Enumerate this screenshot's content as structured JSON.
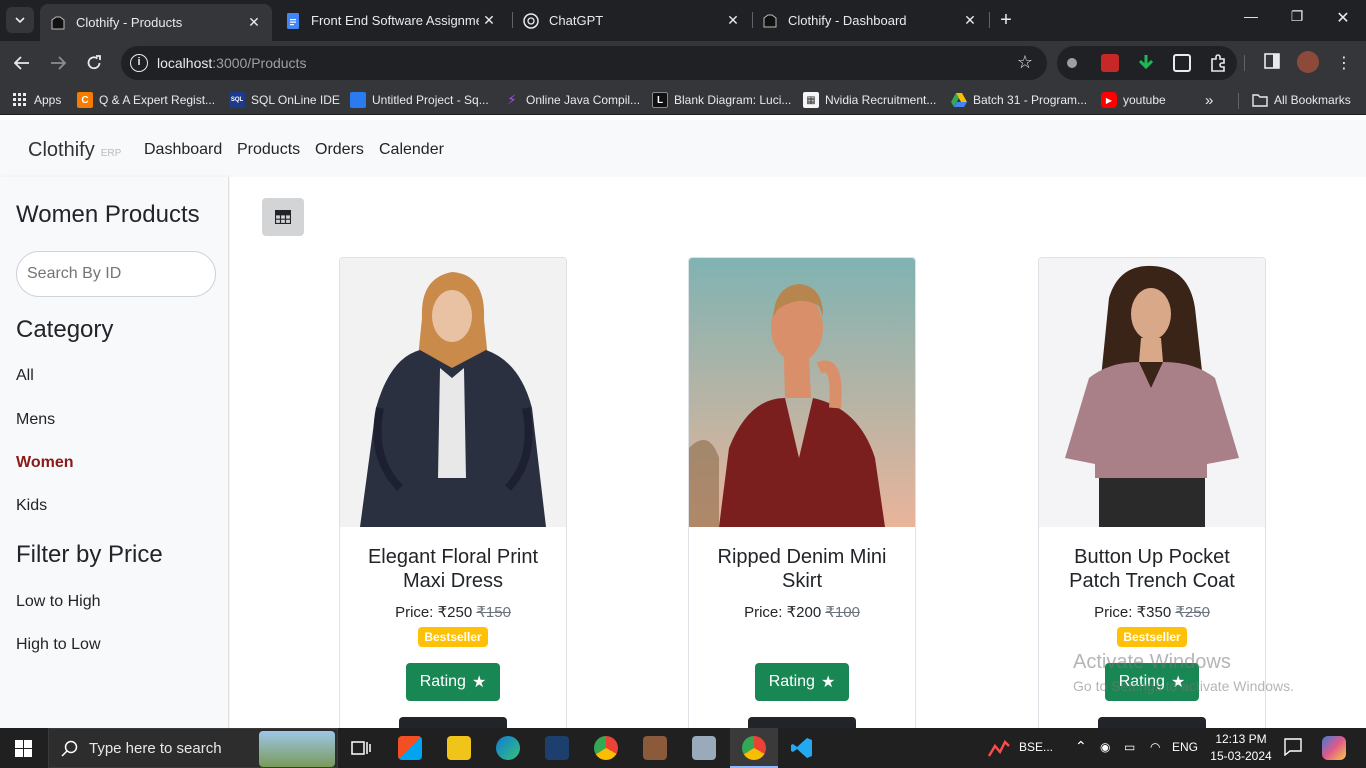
{
  "browser": {
    "tabs": [
      {
        "title": "Clothify - Products",
        "active": true
      },
      {
        "title": "Front End Software Assignment",
        "active": false
      },
      {
        "title": "ChatGPT",
        "active": false
      },
      {
        "title": "Clothify - Dashboard",
        "active": false
      }
    ],
    "url_host": "localhost",
    "url_path": ":3000/Products",
    "bookmarks": [
      {
        "label": "Apps",
        "icon": "apps-grid-icon",
        "color": "#e8eaed"
      },
      {
        "label": "Q & A Expert Regist...",
        "icon": "c-icon",
        "color": "#f57c00"
      },
      {
        "label": "SQL OnLine IDE",
        "icon": "sql-icon",
        "color": "#1e3a8a"
      },
      {
        "label": "Untitled Project - Sq...",
        "icon": "doc-icon",
        "color": "#2b7bf0"
      },
      {
        "label": "Online Java Compil...",
        "icon": "bolt-icon",
        "color": "#7c3aed"
      },
      {
        "label": "Blank Diagram: Luci...",
        "icon": "lucid-icon",
        "color": "#111111"
      },
      {
        "label": "Nvidia Recruitment...",
        "icon": "nvidia-icon",
        "color": "#f5f5f5"
      },
      {
        "label": "Batch 31 - Program...",
        "icon": "drive-icon",
        "color": "#34a853"
      },
      {
        "label": "youtube",
        "icon": "youtube-icon",
        "color": "#ff0000"
      }
    ],
    "all_bookmarks": "All Bookmarks"
  },
  "app": {
    "brand": "Clothify",
    "brand_sub": "ERP",
    "nav": [
      "Dashboard",
      "Products",
      "Orders",
      "Calender"
    ]
  },
  "sidebar": {
    "heading": "Women Products",
    "search_placeholder": "Search By ID",
    "category_heading": "Category",
    "categories": [
      "All",
      "Mens",
      "Women",
      "Kids"
    ],
    "active_category": "Women",
    "price_heading": "Filter by Price",
    "price_options": [
      "Low to High",
      "High to Low"
    ]
  },
  "products": [
    {
      "name": "Elegant Floral Print Maxi Dress",
      "price": "Price: ₹250",
      "old_price": "₹150",
      "badge": "Bestseller",
      "rating_label": "Rating"
    },
    {
      "name": "Ripped Denim Mini Skirt",
      "price": "Price: ₹200",
      "old_price": "₹100",
      "badge": "",
      "rating_label": "Rating"
    },
    {
      "name": "Button Up Pocket Patch Trench Coat",
      "price": "Price: ₹350",
      "old_price": "₹250",
      "badge": "Bestseller",
      "rating_label": "Rating"
    }
  ],
  "watermark": {
    "line1": "Activate Windows",
    "line2": "Go to Settings to activate Windows."
  },
  "taskbar": {
    "search_placeholder": "Type here to search",
    "stock": "BSE...",
    "lang": "ENG",
    "time": "12:13 PM",
    "date": "15-03-2024"
  },
  "colors": {
    "accent_green": "#198754",
    "badge_yellow": "#ffc107",
    "active_category": "#8b1a1a"
  }
}
